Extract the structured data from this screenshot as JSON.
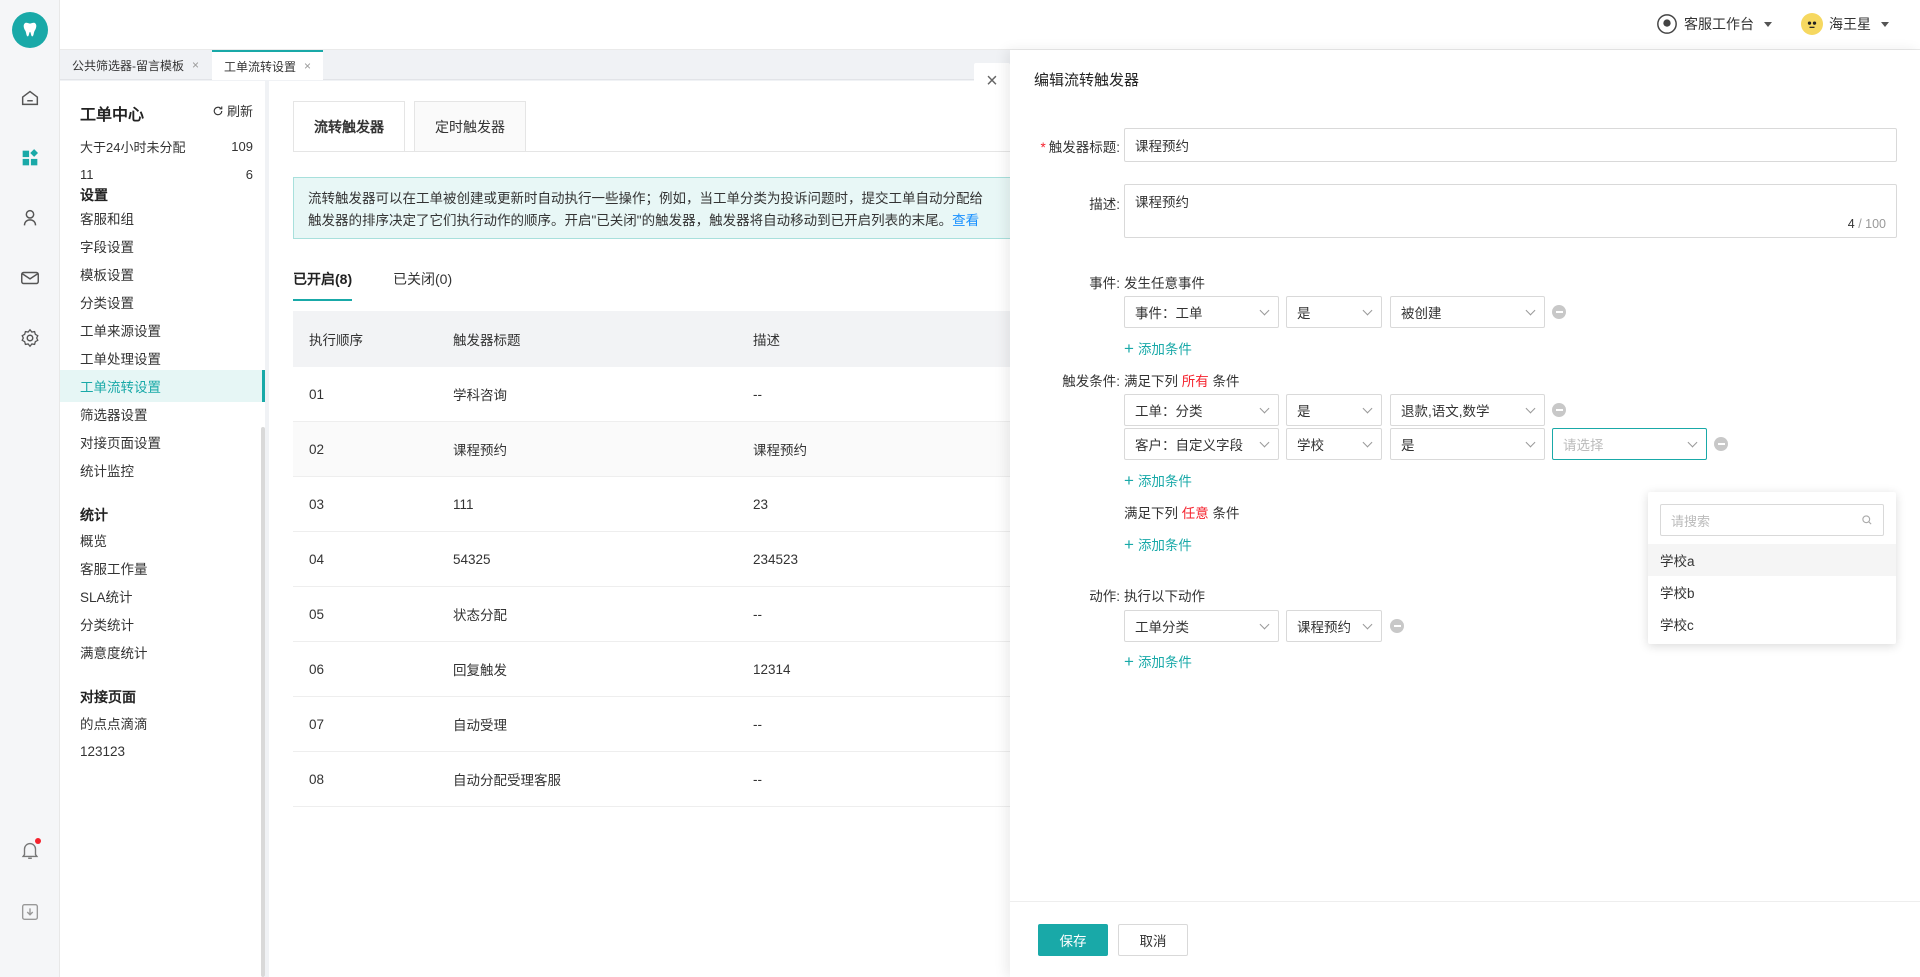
{
  "header": {
    "workbench_label": "客服工作台",
    "user_name": "海王星"
  },
  "page_tabs": [
    {
      "label": "公共筛选器-留言模板",
      "close": "×"
    },
    {
      "label": "工单流转设置",
      "close": "×"
    }
  ],
  "sidebar": {
    "title": "工单中心",
    "refresh_label": "刷新",
    "counters": [
      {
        "label": "大于24小时未分配",
        "count": "109"
      },
      {
        "label": "11",
        "count": "6"
      }
    ],
    "sections": [
      {
        "title": "设置",
        "items": [
          "客服和组",
          "字段设置",
          "模板设置",
          "分类设置",
          "工单来源设置",
          "工单处理设置",
          "工单流转设置",
          "筛选器设置",
          "对接页面设置",
          "统计监控"
        ]
      },
      {
        "title": "统计",
        "items": [
          "概览",
          "客服工作量",
          "SLA统计",
          "分类统计",
          "满意度统计"
        ]
      },
      {
        "title": "对接页面",
        "items": [
          "的点点滴滴",
          "123123"
        ]
      }
    ],
    "active_item": "工单流转设置"
  },
  "main": {
    "tabs": [
      "流转触发器",
      "定时触发器"
    ],
    "notice_line1": "流转触发器可以在工单被创建或更新时自动执行一些操作；例如，当工单分类为投诉问题时，提交工单自动分配给",
    "notice_line2": "触发器的排序决定了它们执行动作的顺序。开启\"已关闭\"的触发器，触发器将自动移动到已开启列表的末尾。",
    "notice_link": "查看",
    "subtabs": [
      "已开启(8)",
      "已关闭(0)"
    ],
    "columns": [
      "执行顺序",
      "触发器标题",
      "描述"
    ],
    "rows": [
      [
        "01",
        "学科咨询",
        "--"
      ],
      [
        "02",
        "课程预约",
        "课程预约"
      ],
      [
        "03",
        "111",
        "23"
      ],
      [
        "04",
        "54325",
        "234523"
      ],
      [
        "05",
        "状态分配",
        "--"
      ],
      [
        "06",
        "回复触发",
        "12314"
      ],
      [
        "07",
        "自动受理",
        "--"
      ],
      [
        "08",
        "自动分配受理客服",
        "--"
      ]
    ]
  },
  "drawer": {
    "close_icon": "×",
    "title": "编辑流转触发器",
    "trigger_title_label": "触发器标题:",
    "trigger_title_value": "课程预约",
    "desc_label": "描述:",
    "desc_value": "课程预约",
    "desc_count": "4",
    "desc_max": "/ 100",
    "event_label": "事件:",
    "event_text": "发生任意事件",
    "event_row": [
      "事件：工单",
      "是",
      "被创建"
    ],
    "add_condition": "添加条件",
    "cond_label": "触发条件:",
    "all_prefix": "满足下列",
    "all_word": "所有",
    "cond_suffix": "条件",
    "cond_row1": [
      "工单：分类",
      "是",
      "退款,语文,数学"
    ],
    "cond_row2": [
      "客户：自定义字段",
      "学校",
      "是"
    ],
    "select_placeholder": "请选择",
    "any_word": "任意",
    "action_label": "动作:",
    "action_text": "执行以下动作",
    "action_row": [
      "工单分类",
      "课程预约"
    ],
    "dropdown": {
      "search_placeholder": "请搜索",
      "options": [
        "学校a",
        "学校b",
        "学校c"
      ]
    },
    "save_label": "保存",
    "cancel_label": "取消"
  },
  "colors": {
    "accent": "#19a9a8",
    "required": "#f5222d",
    "link": "#1890ff"
  }
}
